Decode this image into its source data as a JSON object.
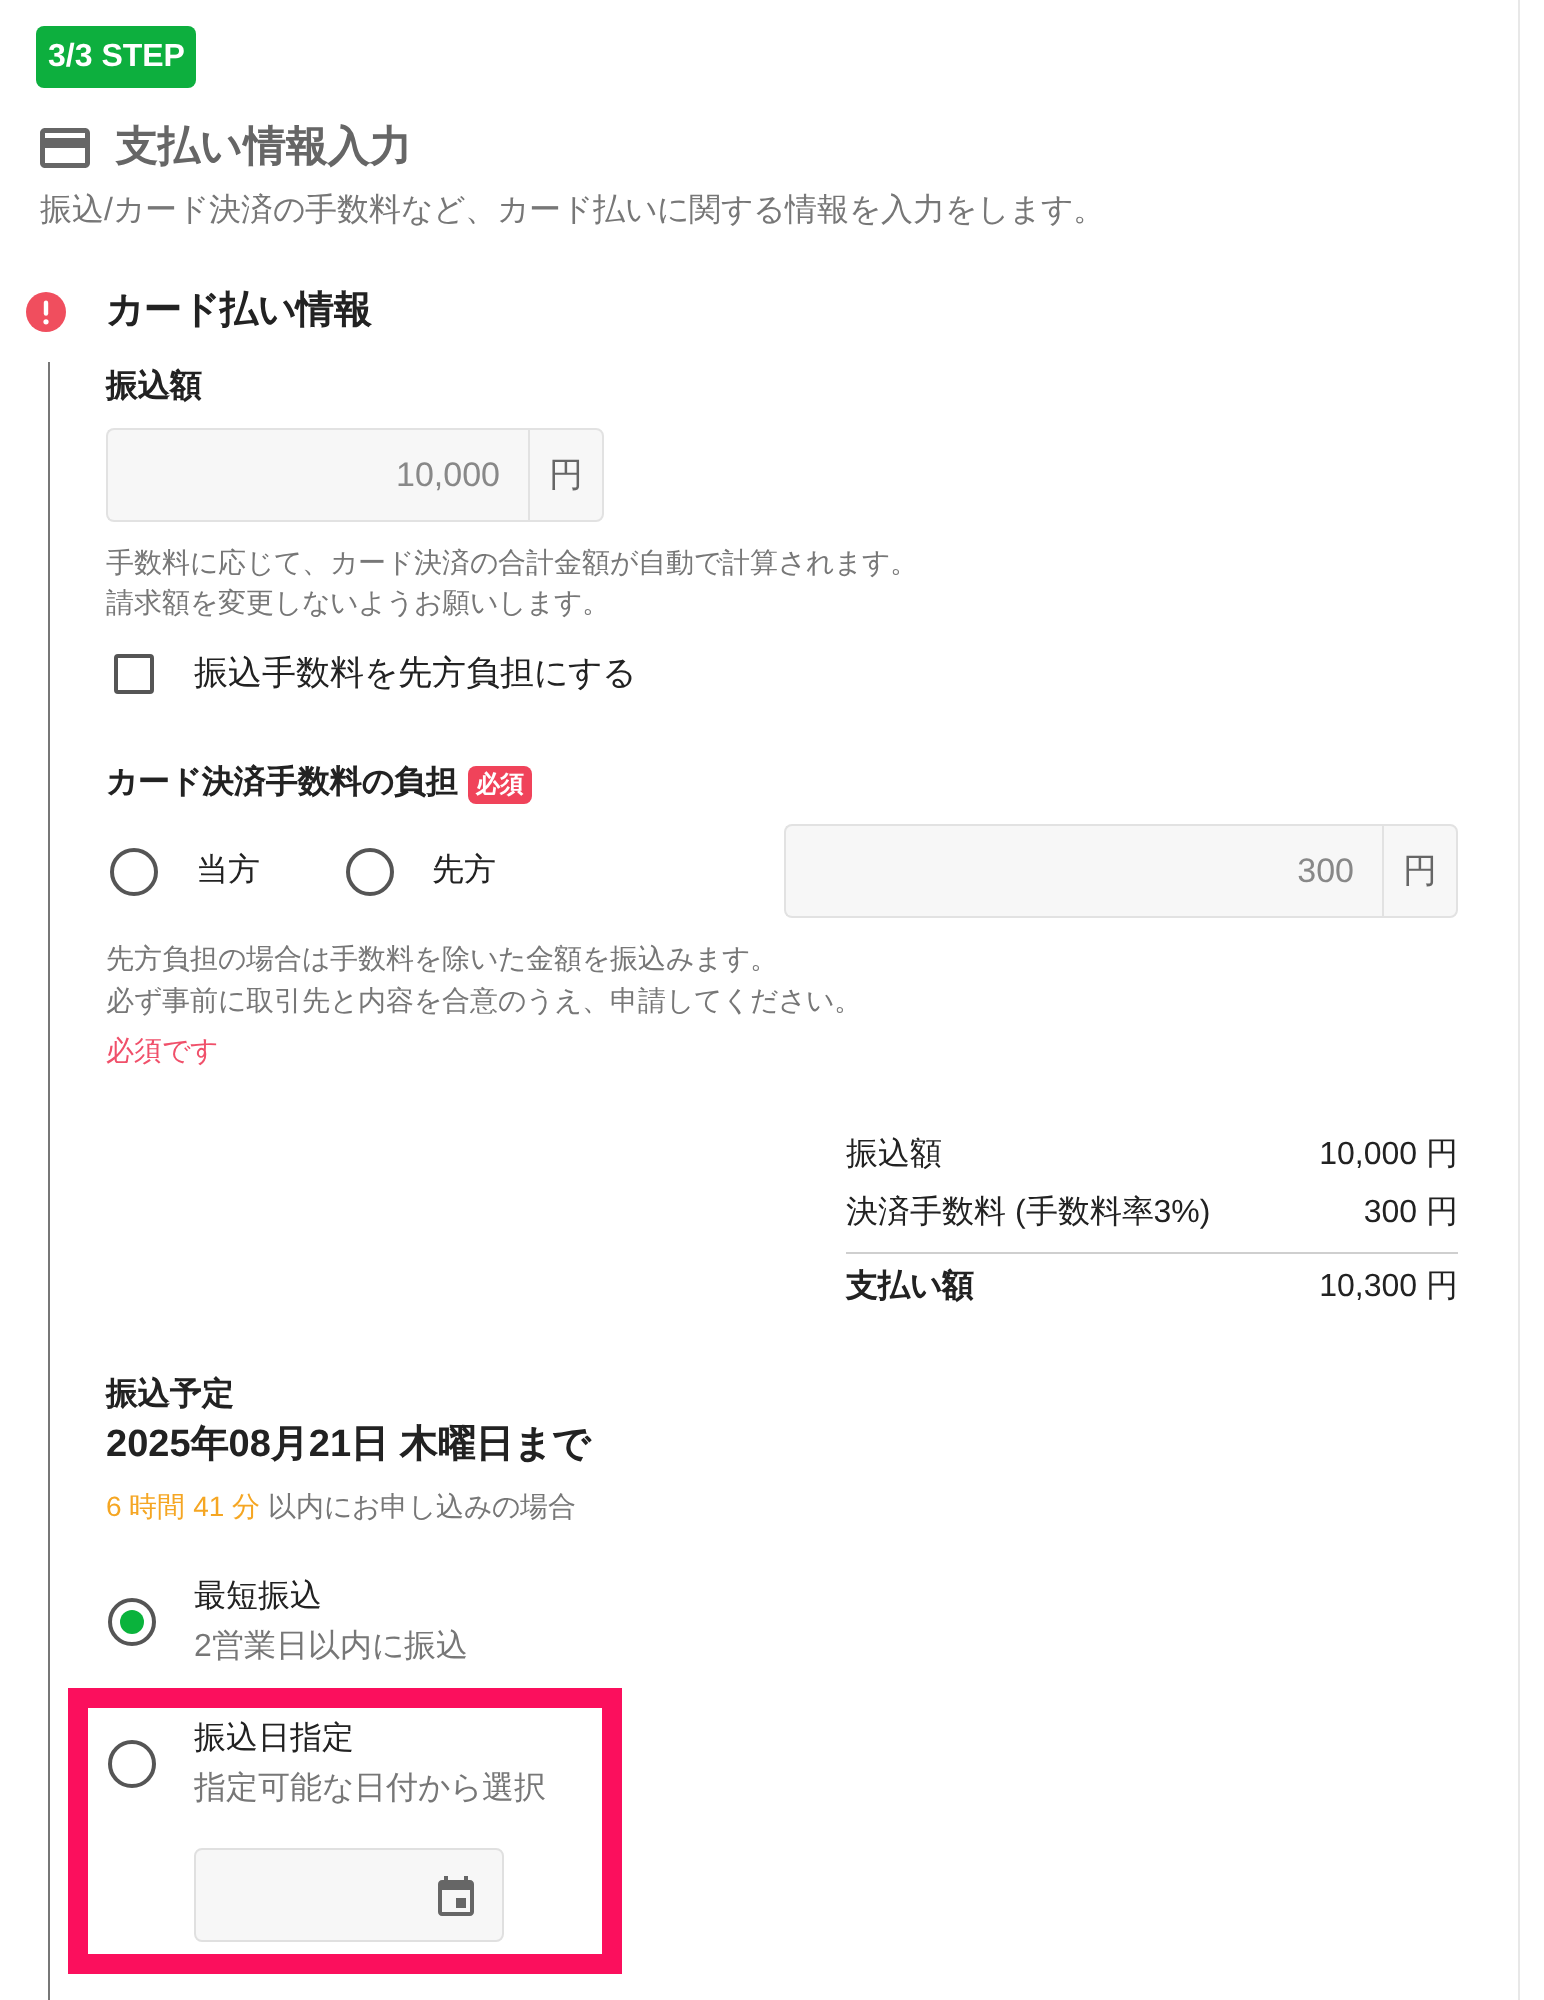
{
  "step_badge": "3/3 STEP",
  "page": {
    "title": "支払い情報入力",
    "description": "振込/カード決済の手数料など、カード払いに関する情報を入力をします。"
  },
  "section": {
    "title": "カード払い情報",
    "error": true,
    "transfer_amount": {
      "label": "振込額",
      "value": "10,000",
      "unit": "円",
      "disabled": true,
      "help": [
        "手数料に応じて、カード決済の合計金額が自動で計算されます。",
        "請求額を変更しないようお願いします。"
      ]
    },
    "fee_checkbox": {
      "label": "振込手数料を先方負担にする",
      "checked": false
    },
    "card_fee": {
      "label": "カード決済手数料の負担",
      "required_badge": "必須",
      "options": [
        {
          "label": "当方",
          "selected": false
        },
        {
          "label": "先方",
          "selected": false
        }
      ],
      "value": "300",
      "unit": "円",
      "disabled": true,
      "help": [
        "先方負担の場合は手数料を除いた金額を振込みます。",
        "必ず事前に取引先と内容を合意のうえ、申請してください。"
      ],
      "error": "必須です"
    },
    "summary": {
      "rows": [
        {
          "label": "振込額",
          "value": "10,000 円"
        },
        {
          "label": "決済手数料 (手数料率3%)",
          "value": "300 円"
        }
      ],
      "total": {
        "label": "支払い額",
        "value": "10,300 円"
      }
    },
    "schedule": {
      "label": "振込予定",
      "date": "2025年08月21日 木曜日まで",
      "countdown": "6 時間 41 分",
      "note": "以内にお申し込みの場合",
      "options": [
        {
          "kind": "standard",
          "title": "最短振込",
          "subtitle": "2営業日以内に振込",
          "selected": true,
          "highlighted": false
        },
        {
          "kind": "date",
          "title": "振込日指定",
          "subtitle": "指定可能な日付から選択",
          "selected": false,
          "highlighted": true
        }
      ]
    }
  }
}
